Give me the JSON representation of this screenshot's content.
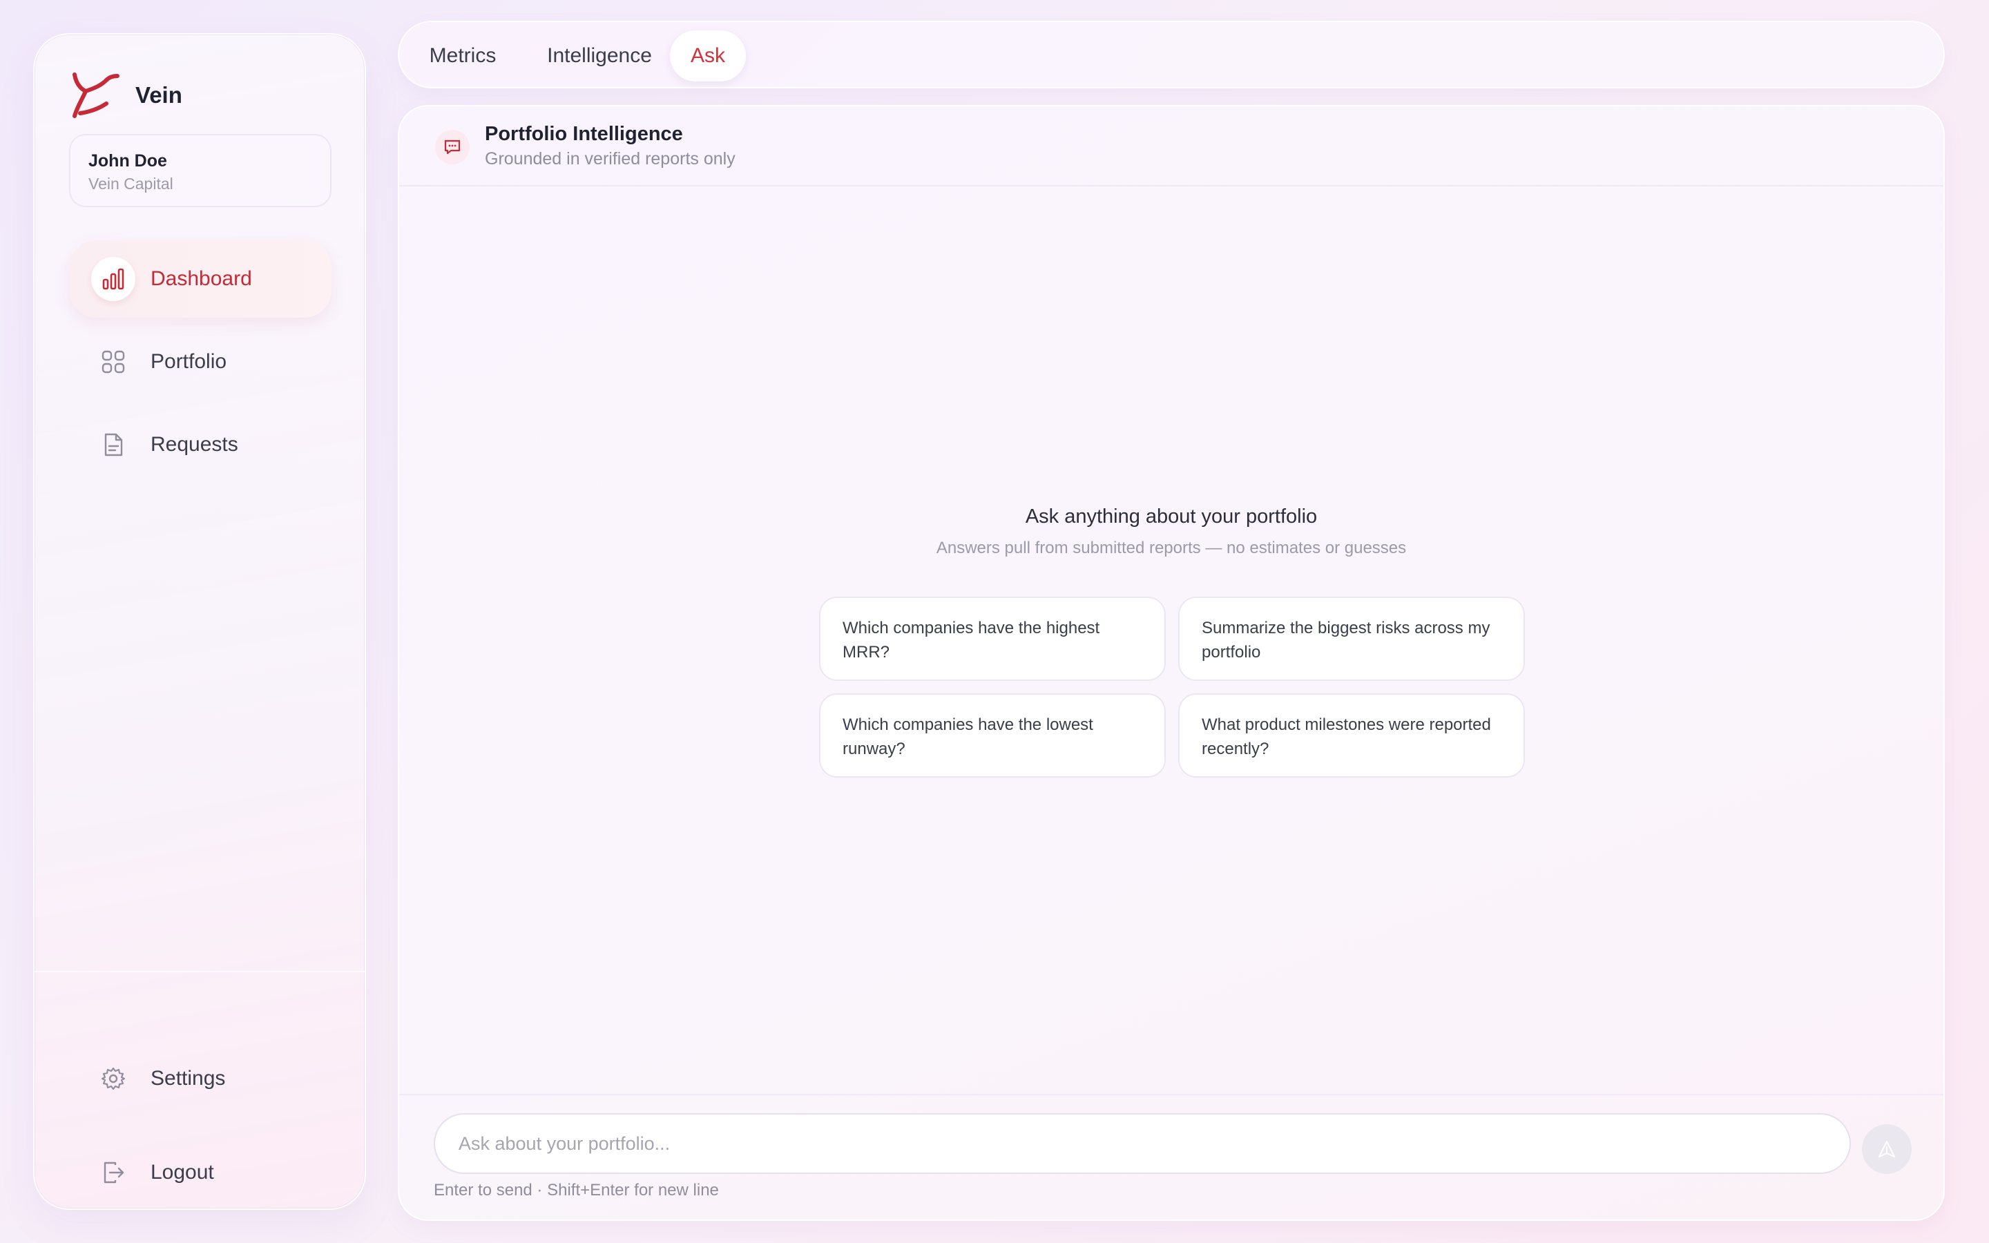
{
  "brand": {
    "name": "Vein",
    "logo_icon": "vein-logo-icon",
    "accent_color": "#c62a36"
  },
  "user": {
    "name": "John Doe",
    "organization": "Vein Capital"
  },
  "sidebar": {
    "nav_items": [
      {
        "label": "Dashboard",
        "icon": "bar-chart-icon",
        "active": true
      },
      {
        "label": "Portfolio",
        "icon": "grid-icon",
        "active": false
      },
      {
        "label": "Requests",
        "icon": "document-icon",
        "active": false
      }
    ],
    "bottom_items": [
      {
        "label": "Settings",
        "icon": "gear-icon"
      },
      {
        "label": "Logout",
        "icon": "logout-icon"
      }
    ]
  },
  "tabs": [
    {
      "label": "Metrics",
      "active": false
    },
    {
      "label": "Intelligence",
      "active": false
    },
    {
      "label": "Ask",
      "active": true
    }
  ],
  "panel": {
    "title": "Portfolio Intelligence",
    "subtitle": "Grounded in verified reports only",
    "icon": "chat-bubble-icon"
  },
  "empty_state": {
    "title": "Ask anything about your portfolio",
    "subtitle": "Answers pull from submitted reports — no estimates or guesses"
  },
  "suggestions": [
    "Which companies have the highest MRR?",
    "Summarize the biggest risks across my portfolio",
    "Which companies have the lowest runway?",
    "What product milestones were reported recently?"
  ],
  "composer": {
    "placeholder": "Ask about your portfolio...",
    "value": "",
    "hint": "Enter to send · Shift+Enter for new line",
    "send_icon": "send-icon"
  }
}
